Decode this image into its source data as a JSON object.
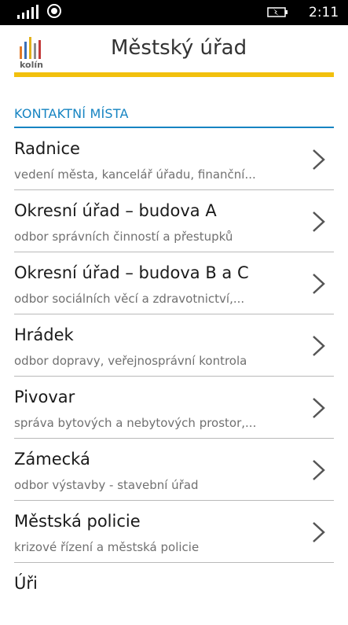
{
  "status_bar": {
    "time": "2:11"
  },
  "header": {
    "logo_text": "kolín",
    "title": "Městský úřad"
  },
  "colors": {
    "accent": "#f2c00d",
    "section": "#1684c2"
  },
  "section": {
    "title": "KONTAKTNÍ MÍSTA"
  },
  "items": [
    {
      "title": "Radnice",
      "subtitle": "vedení města, kancelář úřadu, finanční..."
    },
    {
      "title": "Okresní úřad – budova A",
      "subtitle": "odbor správních činností a přestupků"
    },
    {
      "title": "Okresní úřad – budova B a C",
      "subtitle": "odbor sociálních věcí a zdravotnictví,..."
    },
    {
      "title": "Hrádek",
      "subtitle": "odbor dopravy, veřejnosprávní kontrola"
    },
    {
      "title": "Pivovar",
      "subtitle": "správa bytových a nebytových prostor,..."
    },
    {
      "title": "Zámecká",
      "subtitle": "odbor výstavby - stavební úřad"
    },
    {
      "title": "Městská policie",
      "subtitle": "krizové řízení a městská policie"
    },
    {
      "title": "Úři",
      "subtitle": ""
    }
  ],
  "icons": {
    "chevron": "chevron-right-icon"
  }
}
